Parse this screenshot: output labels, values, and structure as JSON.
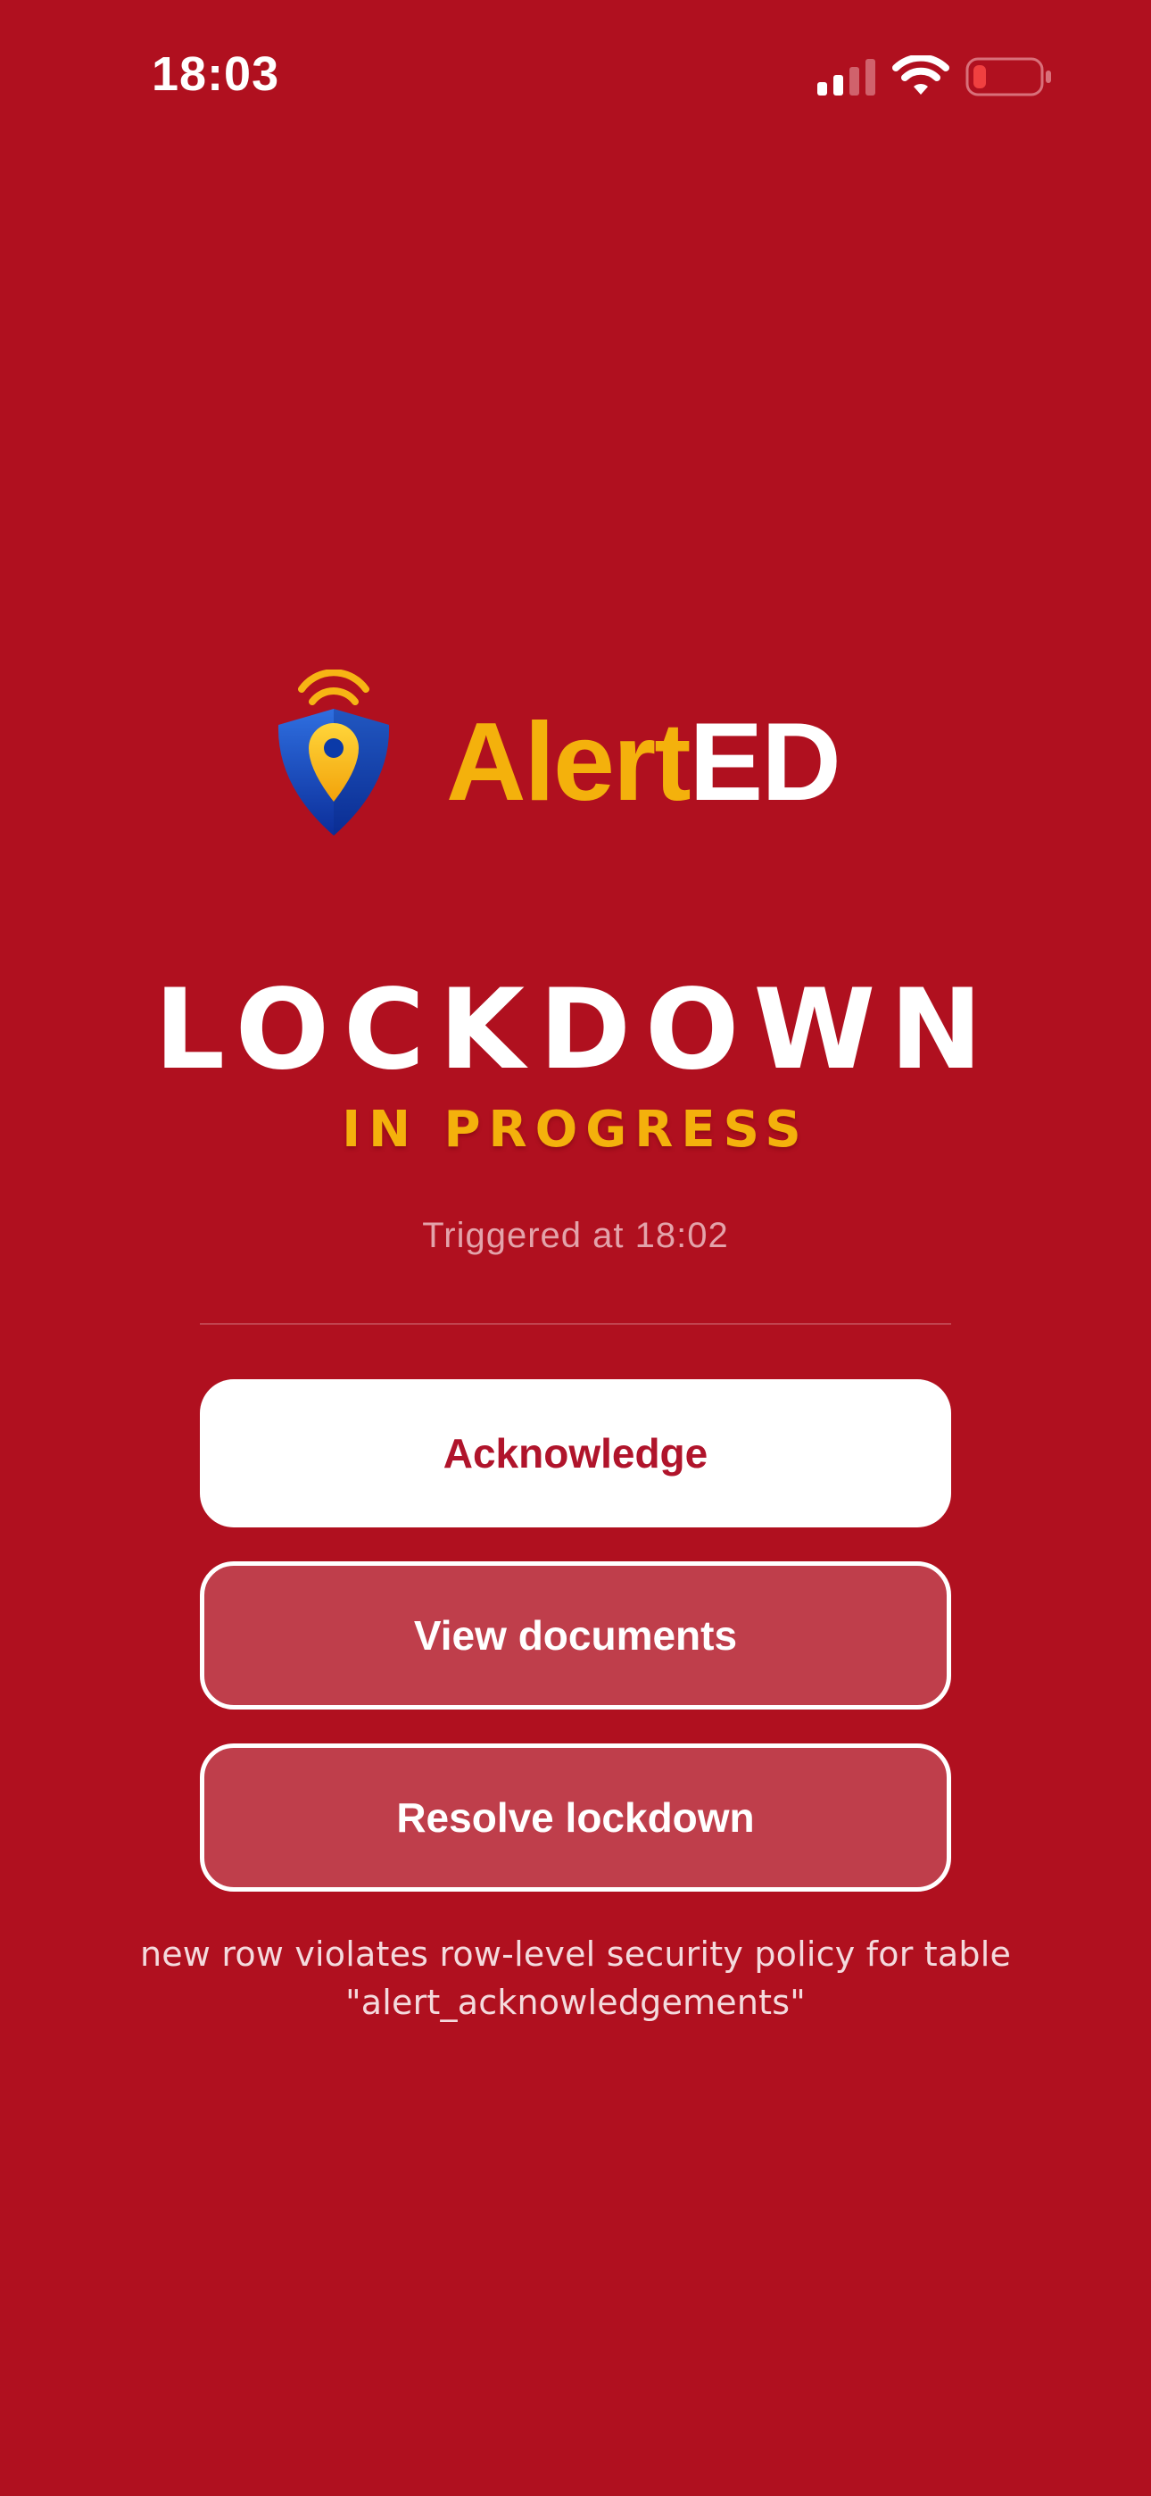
{
  "status_bar": {
    "time": "18:03",
    "icons": [
      "signal-icon",
      "wifi-icon",
      "battery-low-icon"
    ]
  },
  "logo": {
    "icon": "shield-location-pin-icon",
    "word_part_1": "Alert",
    "word_part_2": "ED"
  },
  "alert": {
    "title": "LOCKDOWN",
    "subtitle": "IN PROGRESS",
    "triggered_text": "Triggered at 18:02"
  },
  "actions": {
    "acknowledge_label": "Acknowledge",
    "view_documents_label": "View documents",
    "resolve_label": "Resolve lockdown"
  },
  "error": {
    "message": "new row violates row-level security policy for table \"alert_acknowledgements\""
  },
  "colors": {
    "background": "#B0101F",
    "accent_yellow": "#F4B10C",
    "primary_button_text": "#B0142B",
    "outline_button_fill": "#BF3E4B"
  }
}
